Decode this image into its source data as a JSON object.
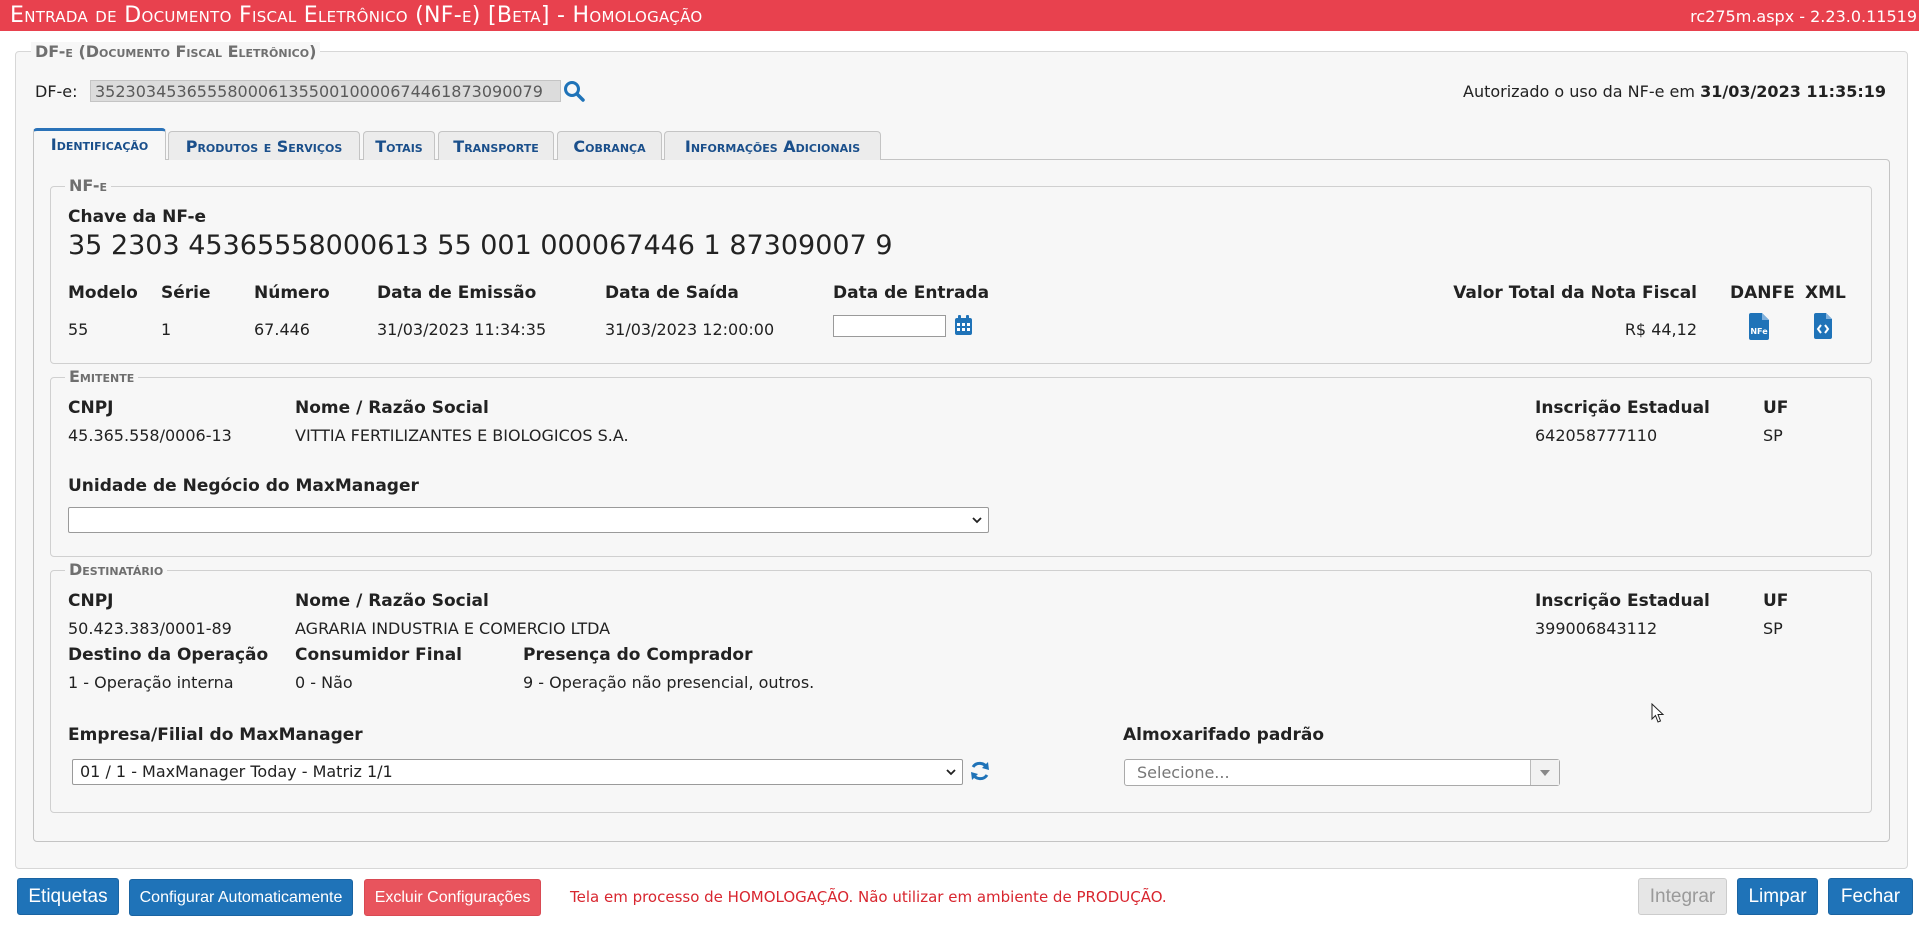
{
  "title": "Entrada de Documento Fiscal Eletrônico (NF-e) [Beta]  - Homologação",
  "version": "rc275m.aspx - 2.23.0.11519",
  "outer_legend": "DF-e (Documento Fiscal Eletrônico)",
  "dfe": {
    "label": "DF-e:",
    "value": "35230345365558000613550010000674461873090079",
    "status_prefix": "Autorizado o uso da NF-e em ",
    "status_date": "31/03/2023 11:35:19"
  },
  "tabs": [
    {
      "label": "Identificação",
      "active": true
    },
    {
      "label": "Produtos e Serviços",
      "active": false
    },
    {
      "label": "Totais",
      "active": false
    },
    {
      "label": "Transporte",
      "active": false
    },
    {
      "label": "Cobrança",
      "active": false
    },
    {
      "label": "Informações Adicionais",
      "active": false
    }
  ],
  "nfe": {
    "legend": "NF-e",
    "chave_label": "Chave da NF-e",
    "chave_value": "35 2303 45365558000613 55 001 000067446 1 87309007 9",
    "headers": {
      "modelo": "Modelo",
      "serie": "Série",
      "numero": "Número",
      "emissao": "Data de Emissão",
      "saida": "Data de Saída",
      "entrada": "Data de Entrada",
      "valor": "Valor Total da Nota Fiscal",
      "danfe": "DANFE",
      "xml": "XML"
    },
    "values": {
      "modelo": "55",
      "serie": "1",
      "numero": "67.446",
      "emissao": "31/03/2023 11:34:35",
      "saida": "31/03/2023 12:00:00",
      "entrada": "",
      "valor": "R$ 44,12"
    },
    "danfe_icon_text": "NFe"
  },
  "emitente": {
    "legend": "Emitente",
    "cnpj_label": "CNPJ",
    "cnpj": "45.365.558/0006-13",
    "nome_label": "Nome / Razão Social",
    "nome": "VITTIA FERTILIZANTES E BIOLOGICOS S.A.",
    "ie_label": "Inscrição Estadual",
    "ie": "642058777110",
    "uf_label": "UF",
    "uf": "SP",
    "unidade_label": "Unidade de Negócio do MaxManager",
    "unidade_value": ""
  },
  "destinatario": {
    "legend": "Destinatário",
    "cnpj_label": "CNPJ",
    "cnpj": "50.423.383/0001-89",
    "nome_label": "Nome / Razão Social",
    "nome": "AGRARIA INDUSTRIA E COMERCIO LTDA",
    "ie_label": "Inscrição Estadual",
    "ie": "399006843112",
    "uf_label": "UF",
    "uf": "SP",
    "destino_label": "Destino da Operação",
    "destino": "1 - Operação interna",
    "consumidor_label": "Consumidor Final",
    "consumidor": "0 - Não",
    "presenca_label": "Presença do Comprador",
    "presenca": "9 - Operação não presencial, outros.",
    "empresa_label": "Empresa/Filial do MaxManager",
    "empresa_value": "01 / 1 - MaxManager Today - Matriz 1/1",
    "almox_label": "Almoxarifado padrão",
    "almox_placeholder": "Selecione..."
  },
  "footer": {
    "etiquetas": "Etiquetas",
    "configurar": "Configurar Automaticamente",
    "excluir": "Excluir Configurações",
    "warning": "Tela em processo de HOMOLOGAÇÃO. Não utilizar em ambiente de PRODUÇÃO.",
    "integrar": "Integrar",
    "limpar": "Limpar",
    "fechar": "Fechar"
  },
  "colors": {
    "title_bar": "#e8414e",
    "primary_button": "#1f73b8",
    "danger_button": "#e8545d",
    "warning_text": "#d8262f",
    "icon_blue": "#1f73b8"
  },
  "icons": [
    "search-icon",
    "calendar-icon",
    "danfe-icon",
    "xml-icon",
    "chevron-down-icon",
    "refresh-icon",
    "mouse-cursor-icon"
  ]
}
